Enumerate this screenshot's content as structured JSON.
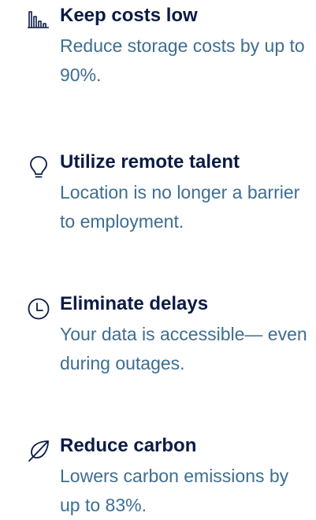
{
  "colors": {
    "title": "#0b1b46",
    "description": "#3d6e92",
    "icon_stroke": "#0b1b46"
  },
  "features": [
    {
      "icon": "bar-chart-icon",
      "title": "Keep costs low",
      "description": "Reduce storage costs by up to 90%."
    },
    {
      "icon": "lightbulb-icon",
      "title": "Utilize remote talent",
      "description": "Location is no longer a barrier to employment."
    },
    {
      "icon": "clock-icon",
      "title": "Eliminate delays",
      "description": "Your data is accessible— even during outages."
    },
    {
      "icon": "leaf-icon",
      "title": "Reduce carbon",
      "description": "Lowers carbon emissions by up to 83%."
    }
  ]
}
